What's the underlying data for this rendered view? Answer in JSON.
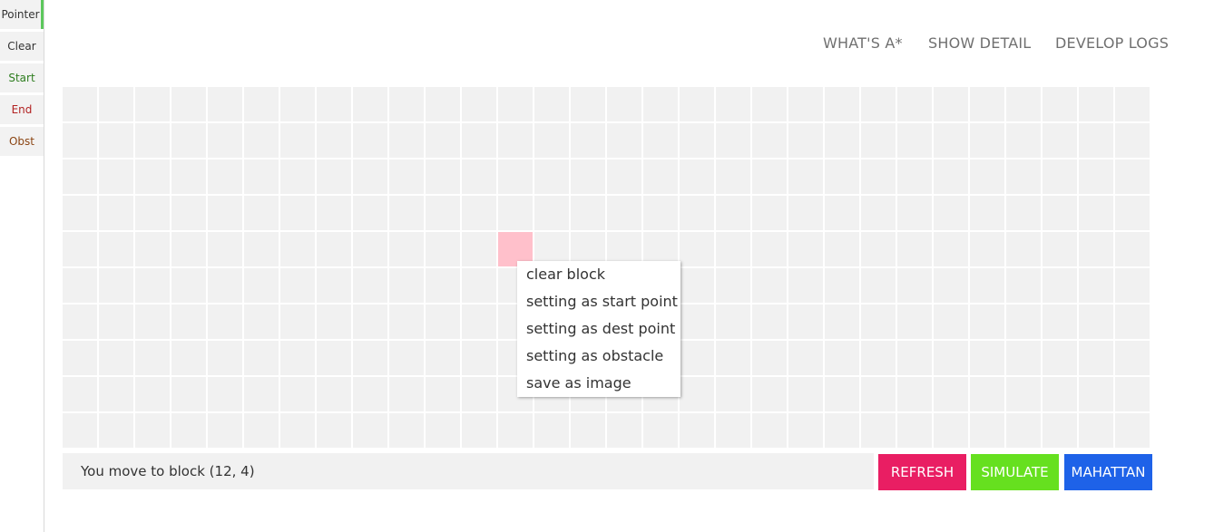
{
  "sidebar": {
    "tools": [
      {
        "label": "Pointer",
        "color": "#333333"
      },
      {
        "label": "Clear",
        "color": "#333333"
      },
      {
        "label": "Start",
        "color": "#2e7d1f"
      },
      {
        "label": "End",
        "color": "#b22222"
      },
      {
        "label": "Obst",
        "color": "#8b4513"
      }
    ],
    "active_tool": "Pointer",
    "active_color": "#5cc85c"
  },
  "nav": {
    "links": [
      {
        "label": "WHAT'S A*"
      },
      {
        "label": "SHOW DETAIL"
      },
      {
        "label": "DEVELOP LOGS"
      }
    ]
  },
  "grid": {
    "columns": 30,
    "rows": 10,
    "hovered_block": {
      "col": 12,
      "row": 4
    },
    "cell_color": "#f1f1f1",
    "hover_color": "#ffc0cb"
  },
  "context_menu": {
    "items": [
      {
        "label": "clear block"
      },
      {
        "label": "setting as start point"
      },
      {
        "label": "setting as dest point"
      },
      {
        "label": "setting as obstacle"
      },
      {
        "label": "save as image"
      }
    ]
  },
  "status": {
    "message": "You move to block (12, 4)"
  },
  "actions": {
    "refresh": {
      "label": "REFRESH",
      "color": "#e91e63"
    },
    "simulate": {
      "label": "SIMULATE",
      "color": "#66e01f"
    },
    "heuristic": {
      "label": "MAHATTAN",
      "color": "#1e62e8"
    }
  }
}
